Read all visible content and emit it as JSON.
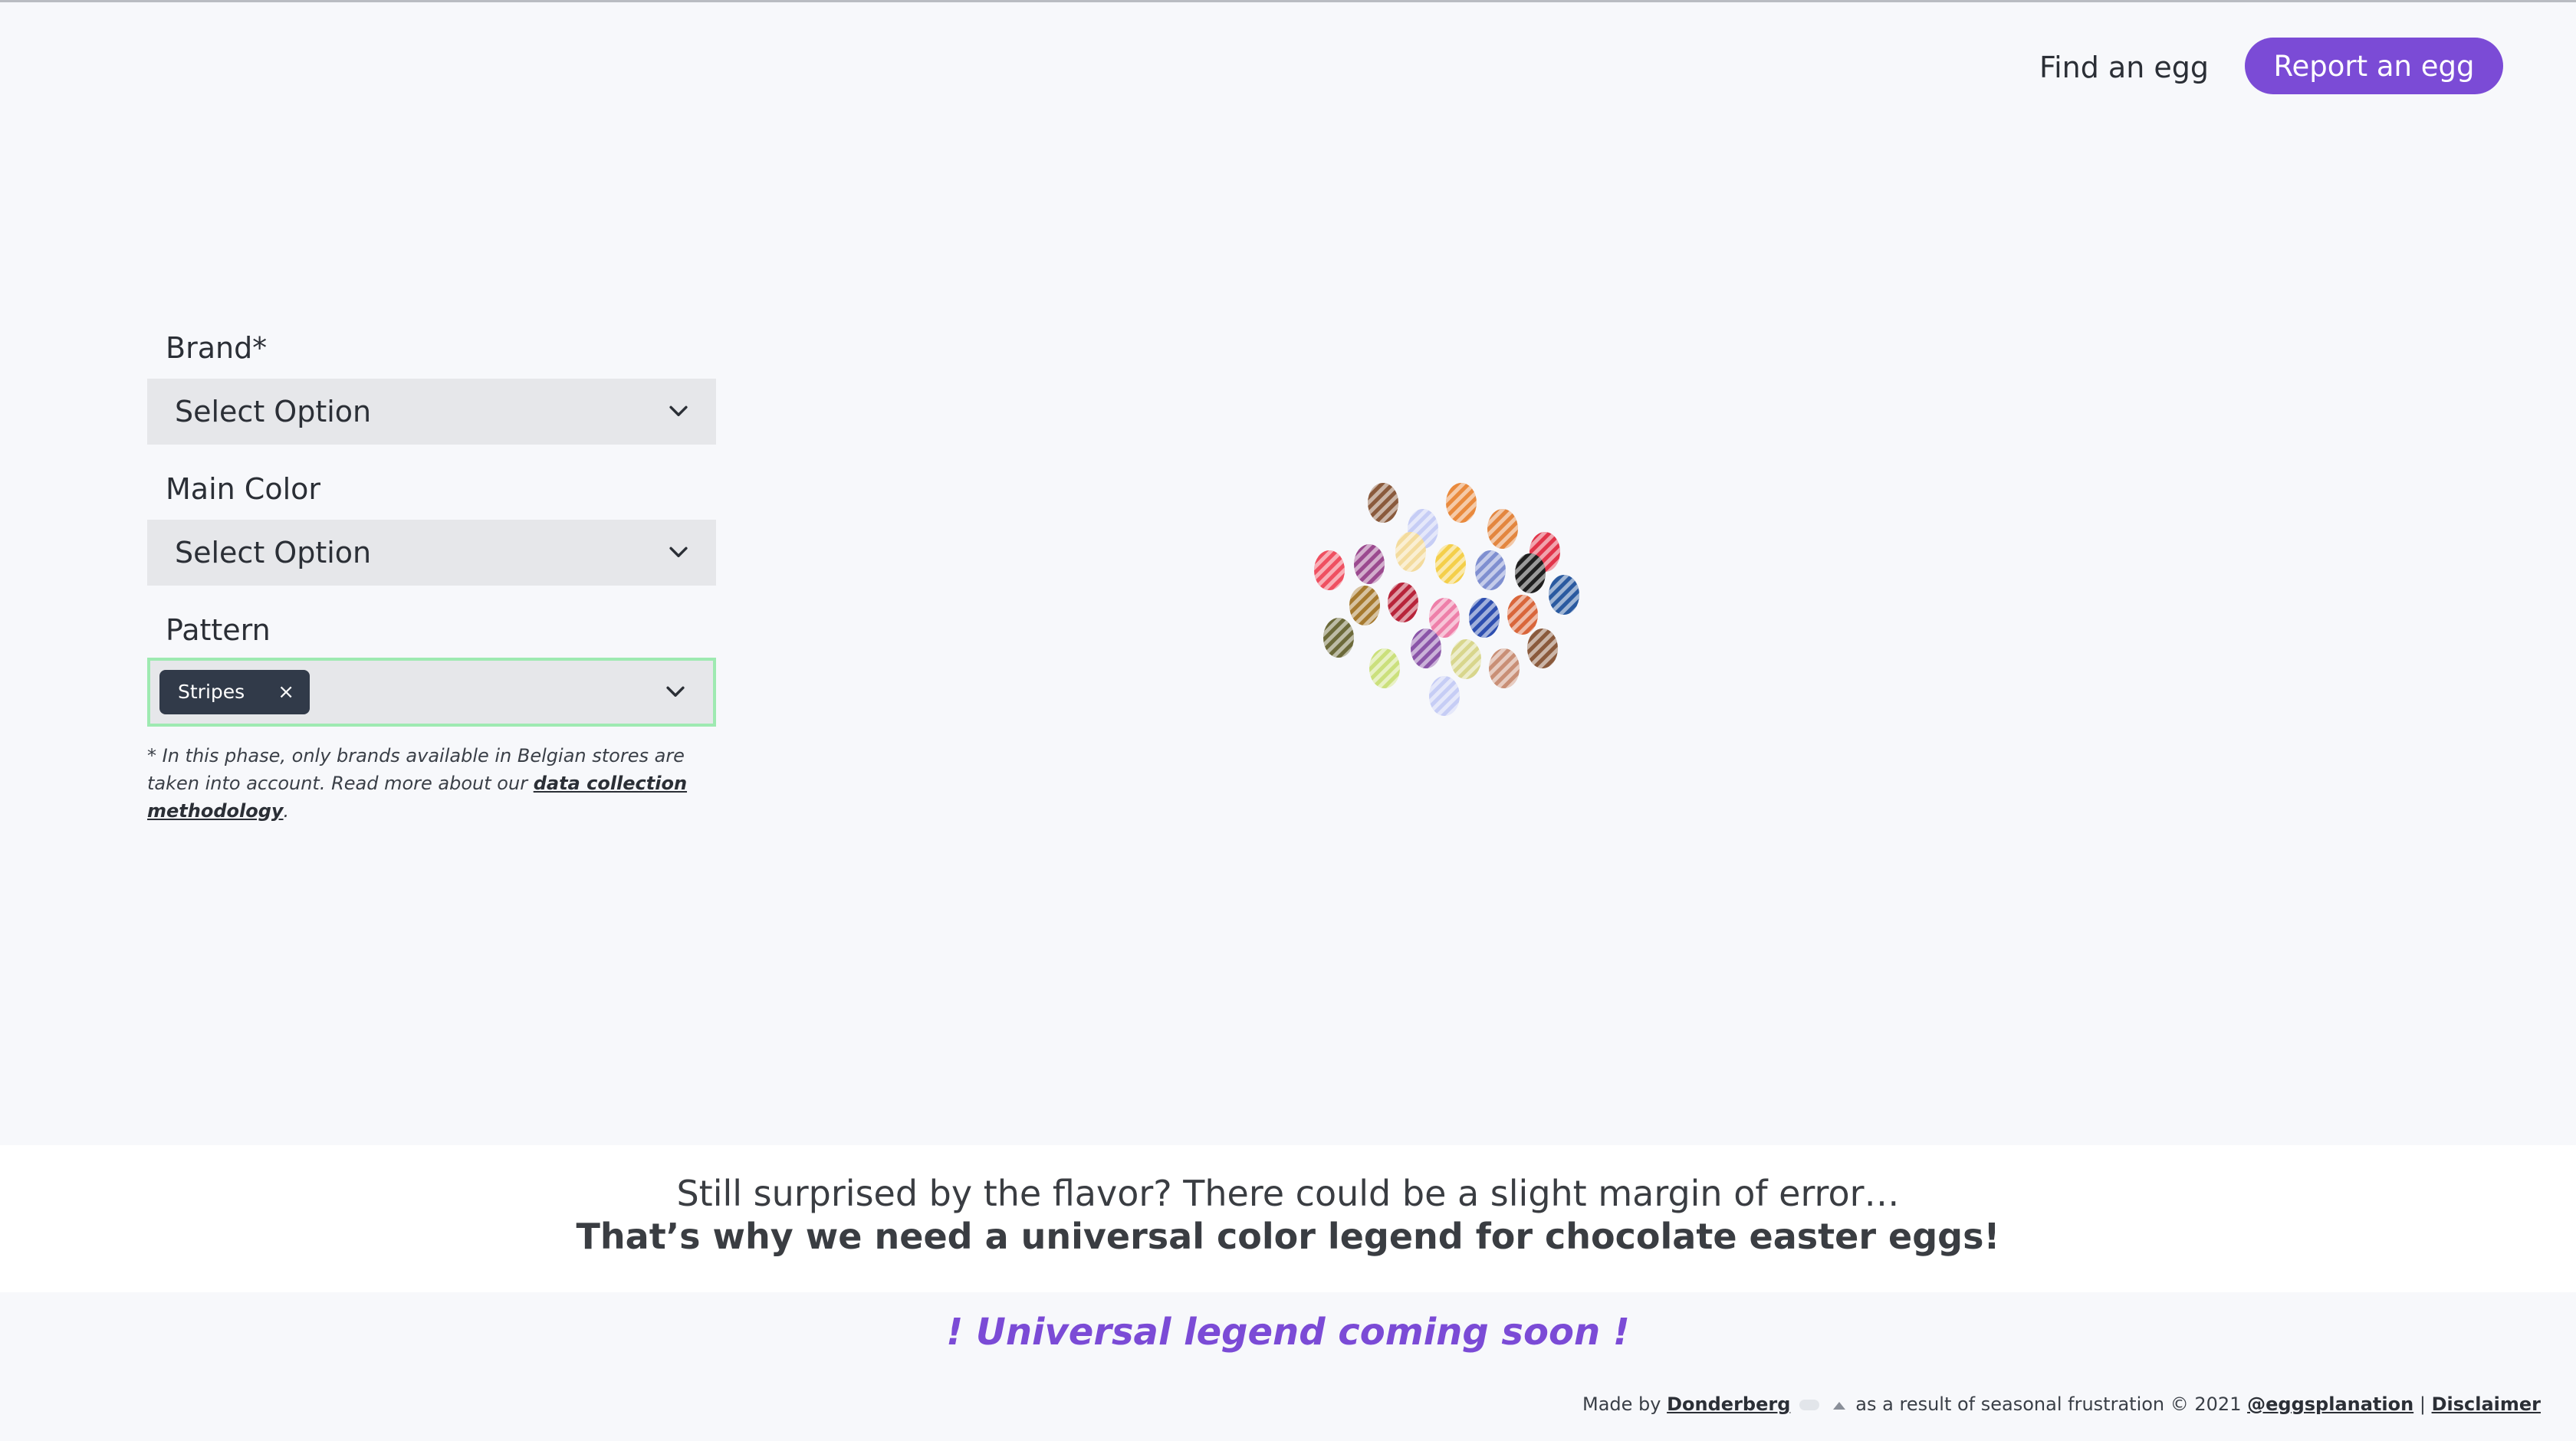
{
  "header": {
    "find_label": "Find an egg",
    "report_label": "Report an egg"
  },
  "form": {
    "brand": {
      "label": "Brand*",
      "value": "Select Option"
    },
    "main_color": {
      "label": "Main Color",
      "value": "Select Option"
    },
    "pattern": {
      "label": "Pattern",
      "selected_chip": "Stripes",
      "chip_remove": "×"
    },
    "note": {
      "text_before": "* In this phase, only brands available in Belgian stores are taken into account. Read more about our ",
      "link": "data collection methodology",
      "text_after": "."
    }
  },
  "eggs_pattern": "stripes",
  "egg_colors": [
    "#8a5a3c",
    "#c6cdf5",
    "#e98a3d",
    "#e3863f",
    "#e1344a",
    "#ef5061",
    "#9b4a8f",
    "#f3db9d",
    "#f4cf4a",
    "#7f8fd0",
    "#1f1f1f",
    "#2a5aa0",
    "#a67a2f",
    "#b8243a",
    "#ee7fa9",
    "#2e4fb0",
    "#d9663b",
    "#6c6a3a",
    "#cbe07c",
    "#8a55a8",
    "#d8d68c",
    "#c98f76"
  ],
  "banner": {
    "line1": "Still surprised by the flavor? There could be a slight margin of error…",
    "line2": "That’s why we need a universal color legend for chocolate easter eggs!"
  },
  "coming_soon": "! Universal legend coming soon !",
  "footer": {
    "made_by": "Made by",
    "author": "Donderberg",
    "middle": "as a result of seasonal frustration © 2021",
    "handle": "@eggsplanation",
    "separator": "|",
    "disclaimer": "Disclaimer"
  }
}
